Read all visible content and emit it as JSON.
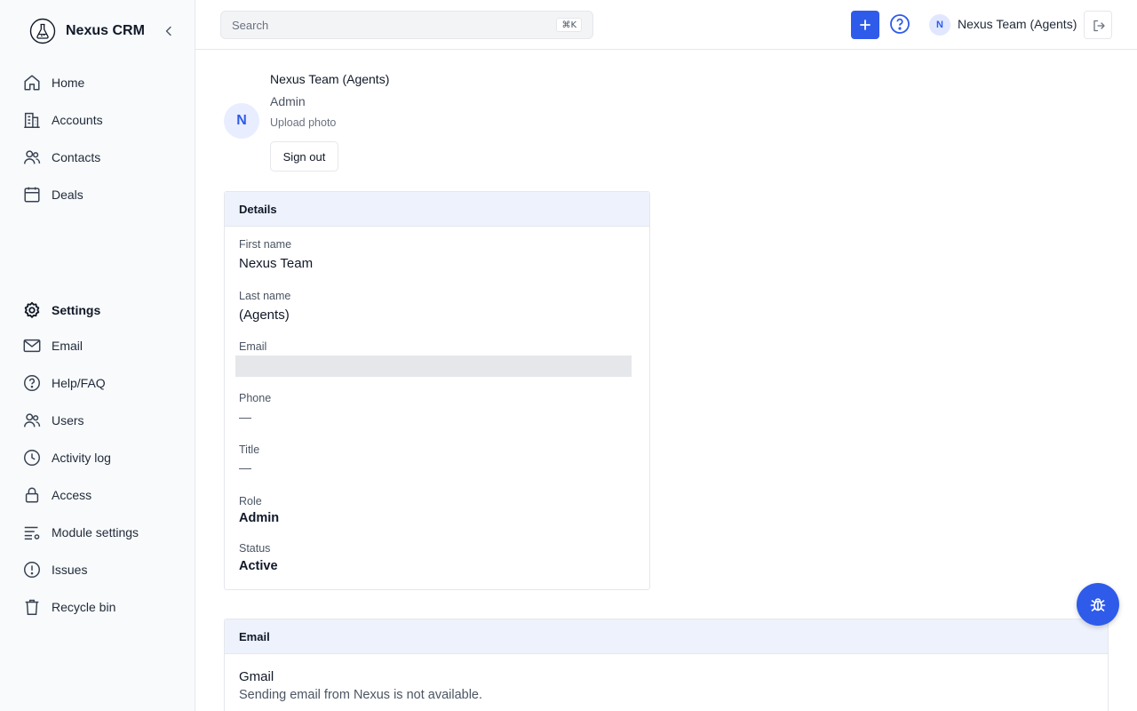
{
  "app": {
    "name": "Nexus CRM"
  },
  "sidebar": {
    "primary": [
      {
        "label": "Home",
        "icon": "home-icon"
      },
      {
        "label": "Accounts",
        "icon": "building-icon"
      },
      {
        "label": "Contacts",
        "icon": "users-icon"
      },
      {
        "label": "Deals",
        "icon": "calendar-icon"
      }
    ],
    "secondary": [
      {
        "label": "Settings",
        "icon": "settings-icon",
        "active": true
      },
      {
        "label": "Email",
        "icon": "mail-icon"
      },
      {
        "label": "Help/FAQ",
        "icon": "help-icon"
      },
      {
        "label": "Users",
        "icon": "users-icon"
      },
      {
        "label": "Activity log",
        "icon": "clock-icon"
      },
      {
        "label": "Access",
        "icon": "lock-icon"
      },
      {
        "label": "Module settings",
        "icon": "list-settings-icon"
      },
      {
        "label": "Issues",
        "icon": "alert-icon"
      },
      {
        "label": "Recycle bin",
        "icon": "trash-icon"
      }
    ]
  },
  "header": {
    "search_placeholder": "Search",
    "search_shortcut": "⌘K",
    "user_initial": "N",
    "user_name": "Nexus Team (Agents)"
  },
  "profile": {
    "initial": "N",
    "name": "Nexus Team (Agents)",
    "role": "Admin",
    "upload_photo": "Upload photo",
    "signout_label": "Sign out"
  },
  "details": {
    "title": "Details",
    "first_name_label": "First name",
    "first_name": "Nexus Team",
    "last_name_label": "Last name",
    "last_name": "(Agents)",
    "email_label": "Email",
    "phone_label": "Phone",
    "phone": "—",
    "title_label": "Title",
    "title_value": "—",
    "role_label": "Role",
    "role": "Admin",
    "status_label": "Status",
    "status": "Active"
  },
  "email_section": {
    "title": "Email",
    "provider": "Gmail",
    "description": "Sending email from Nexus is not available."
  },
  "colors": {
    "accent": "#2f5bea",
    "sidebar_bg": "#f8fafc",
    "card_header_bg": "#eef2fd"
  }
}
